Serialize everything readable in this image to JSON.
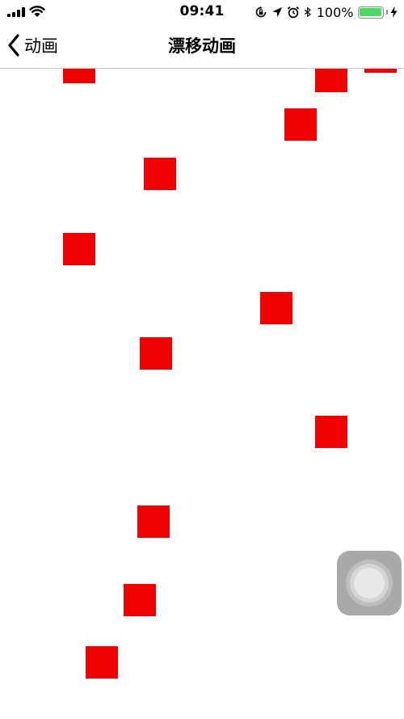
{
  "status_bar": {
    "time": "09:41",
    "battery_percent": "100%",
    "battery_level": 1.0,
    "battery_color": "#4cd964",
    "icons": [
      "signal-icon",
      "wifi-icon",
      "rotation-lock-icon",
      "location-icon",
      "alarm-icon",
      "bluetooth-icon",
      "battery-icon",
      "charging-bolt-icon"
    ]
  },
  "nav": {
    "back_label": "动画",
    "title": "漂移动画",
    "back_icon": "chevron-left-icon"
  },
  "animation": {
    "square_color": "#f00000",
    "square_count": 13
  },
  "assistive_touch": {
    "icon": "assistive-touch-icon"
  }
}
